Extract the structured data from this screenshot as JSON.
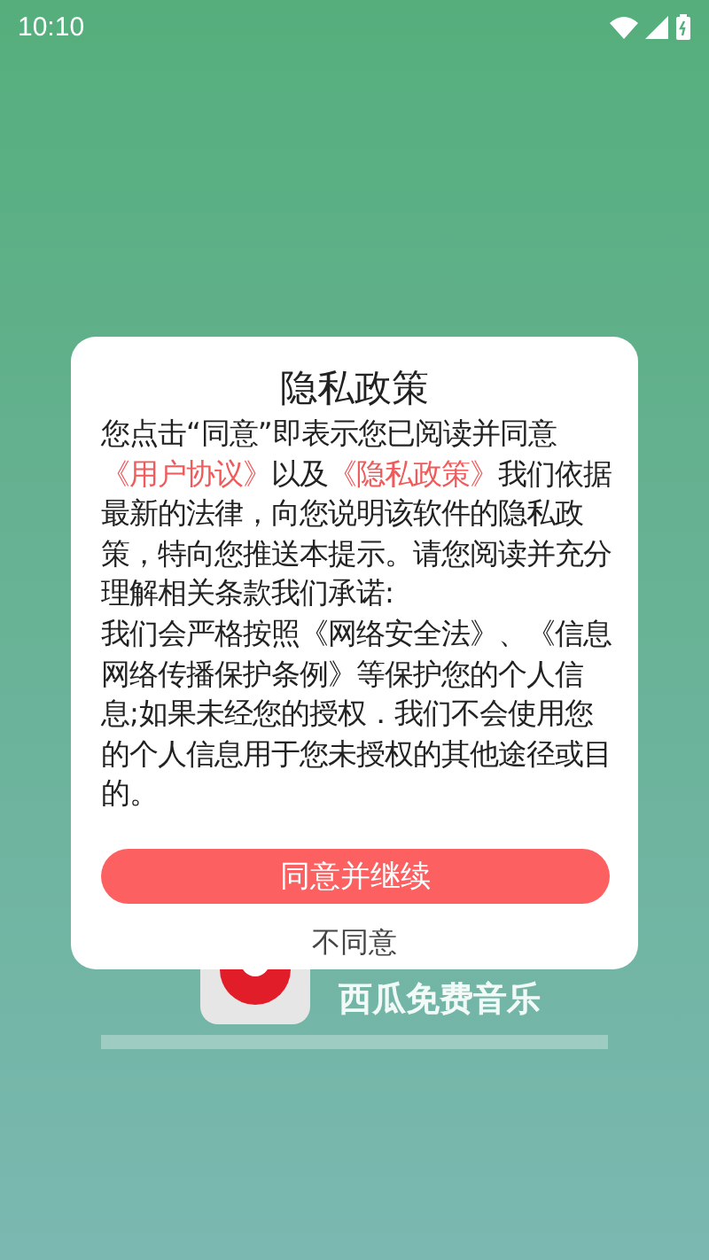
{
  "status_bar": {
    "time": "10:10"
  },
  "background": {
    "app_name": "西瓜免费音乐"
  },
  "dialog": {
    "title": "隐私政策",
    "body": [
      {
        "kind": "text",
        "text": "您点击“同意”即表示您已阅读并同意"
      },
      {
        "kind": "link",
        "text": "《用户协议》"
      },
      {
        "kind": "text",
        "text": "以及"
      },
      {
        "kind": "link",
        "text": "《隐私政策》"
      },
      {
        "kind": "text",
        "text": "我们依据最新的法律，向您说明该软件的隐私政策，特向您推送本提示。请您阅读并充分理解相关条款我们承诺:"
      }
    ],
    "commitment": "我们会严格按照《网络安全法》、《信息网络传播保护条例》等保护您的个人信息;如果未经您的授权．我们不会使用您的个人信息用于您未授权的其他途径或目的。",
    "buttons": [
      {
        "kind": "primary",
        "label": "同意并继续"
      },
      {
        "kind": "plain",
        "label": "不同意"
      }
    ]
  }
}
